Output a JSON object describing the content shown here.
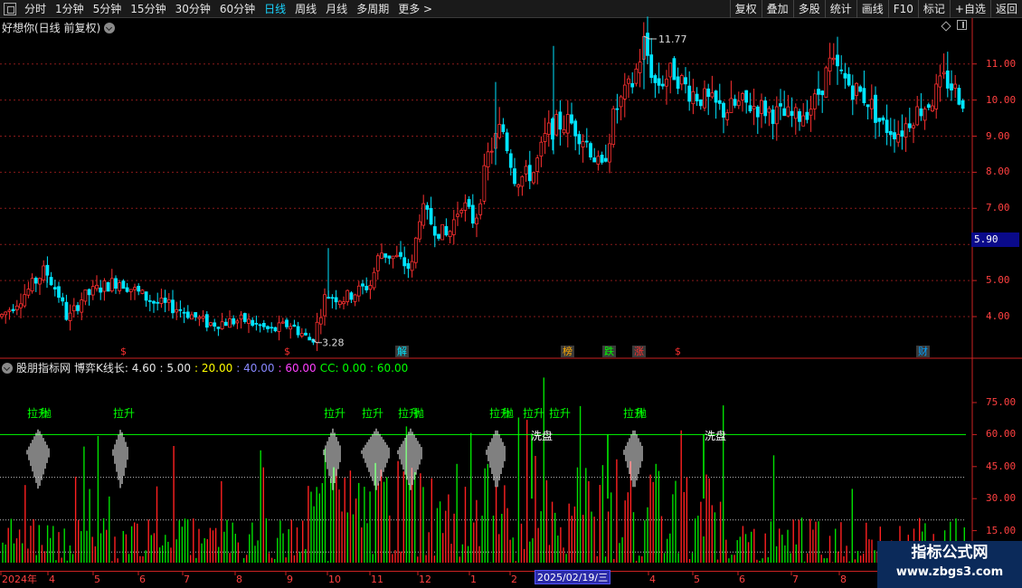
{
  "toolbar": {
    "timeframes": [
      "分时",
      "1分钟",
      "5分钟",
      "15分钟",
      "30分钟",
      "60分钟",
      "日线",
      "周线",
      "月线",
      "多周期",
      "更多 >"
    ],
    "active": "日线",
    "right_buttons": [
      "复权",
      "叠加",
      "多股",
      "统计",
      "画线",
      "F10",
      "标记",
      "+自选",
      "返回"
    ]
  },
  "main_panel": {
    "title": "好想你(日线 前复权)",
    "current_price": "5.90",
    "high_label": "11.77",
    "low_label": "3.28",
    "y_axis": [
      "11.00",
      "10.00",
      "9.00",
      "8.00",
      "7.00",
      "5.00",
      "4.00"
    ],
    "markers": [
      {
        "text": "$",
        "color": "#ff3030",
        "box": false
      },
      {
        "text": "$",
        "color": "#ff3030",
        "box": false
      },
      {
        "text": "解",
        "color": "#00e5ff",
        "box": true
      },
      {
        "text": "榜",
        "color": "#ffaa00",
        "box": true
      },
      {
        "text": "跌",
        "color": "#00ff00",
        "box": true
      },
      {
        "text": "涨",
        "color": "#ff3030",
        "box": true
      },
      {
        "text": "$",
        "color": "#ff3030",
        "box": false
      },
      {
        "text": "财",
        "color": "#00a0ff",
        "box": true
      }
    ]
  },
  "indicator_panel": {
    "name": "股朋指标网",
    "formula": "博弈K线长: 4.60",
    "params": [
      {
        "text": ": 5.00",
        "color": "#e6e6e6"
      },
      {
        "text": ": 20.00",
        "color": "#ffff00"
      },
      {
        "text": ": 40.00",
        "color": "#8888ff"
      },
      {
        "text": ": 60.00",
        "color": "#ff40ff"
      },
      {
        "text": "CC: 0.00",
        "color": "#00ff00"
      },
      {
        "text": ": 60.00",
        "color": "#00ff00"
      }
    ],
    "y_axis": [
      "75.00",
      "60.00",
      "45.00",
      "30.00",
      "15.00"
    ],
    "annotations": [
      {
        "text": "拉升",
        "type": "green"
      },
      {
        "text": "拉升",
        "type": "green"
      },
      {
        "text": "拉升",
        "type": "green"
      },
      {
        "text": "拉升",
        "type": "green"
      },
      {
        "text": "拉升",
        "type": "green"
      },
      {
        "text": "拉升",
        "type": "green"
      },
      {
        "text": "拉升",
        "type": "green"
      },
      {
        "text": "拉升",
        "type": "green"
      },
      {
        "text": "拉升",
        "type": "green"
      },
      {
        "text": "抛",
        "type": "green"
      },
      {
        "text": "抛",
        "type": "green"
      },
      {
        "text": "抛",
        "type": "green"
      },
      {
        "text": "抛",
        "type": "green"
      },
      {
        "text": "洗盘",
        "type": "white"
      },
      {
        "text": "洗盘",
        "type": "white"
      }
    ]
  },
  "date_axis": {
    "labels": [
      "2024年",
      "4",
      "5",
      "6",
      "7",
      "8",
      "9",
      "10",
      "11",
      "12",
      "1",
      "2",
      "4",
      "5",
      "6",
      "7",
      "8",
      "9"
    ],
    "selected": "2025/02/19/三"
  },
  "watermark": {
    "title": "指标公式网",
    "url": "www.zbgs3.com"
  },
  "colors": {
    "up": "#ff3030",
    "down": "#00e5ff",
    "grid": "#8a1a1a",
    "volume_up": "#ff2020",
    "volume_down": "#00e000",
    "line60": "#00ff00"
  },
  "chart_data": {
    "type": "candlestick",
    "title": "好想你(日线 前复权)",
    "ylim": [
      3.0,
      12.2
    ],
    "price_path": [
      [
        0,
        4.0
      ],
      [
        10,
        4.2
      ],
      [
        30,
        4.7
      ],
      [
        50,
        5.3
      ],
      [
        65,
        4.6
      ],
      [
        75,
        3.9
      ],
      [
        90,
        4.5
      ],
      [
        110,
        4.8
      ],
      [
        132,
        5.0
      ],
      [
        150,
        4.7
      ],
      [
        170,
        4.4
      ],
      [
        200,
        4.2
      ],
      [
        230,
        3.8
      ],
      [
        270,
        3.9
      ],
      [
        300,
        3.6
      ],
      [
        320,
        3.8
      ],
      [
        345,
        3.3
      ],
      [
        360,
        4.6
      ],
      [
        380,
        4.5
      ],
      [
        410,
        4.9
      ],
      [
        420,
        5.8
      ],
      [
        440,
        5.6
      ],
      [
        455,
        5.3
      ],
      [
        465,
        7.0
      ],
      [
        480,
        6.5
      ],
      [
        495,
        6.2
      ],
      [
        510,
        7.2
      ],
      [
        525,
        6.6
      ],
      [
        540,
        8.5
      ],
      [
        555,
        9.3
      ],
      [
        570,
        7.8
      ],
      [
        590,
        8.0
      ],
      [
        605,
        9.1
      ],
      [
        615,
        9.3
      ],
      [
        630,
        9.4
      ],
      [
        650,
        8.8
      ],
      [
        665,
        8.0
      ],
      [
        680,
        9.7
      ],
      [
        700,
        10.5
      ],
      [
        712,
        11.6
      ],
      [
        725,
        10.4
      ],
      [
        745,
        10.8
      ],
      [
        760,
        10.3
      ],
      [
        780,
        10.0
      ],
      [
        800,
        9.7
      ],
      [
        820,
        9.9
      ],
      [
        840,
        9.8
      ],
      [
        860,
        9.6
      ],
      [
        880,
        9.5
      ],
      [
        900,
        9.9
      ],
      [
        918,
        11.0
      ],
      [
        940,
        10.4
      ],
      [
        960,
        10.0
      ],
      [
        975,
        9.3
      ],
      [
        995,
        9.1
      ],
      [
        1010,
        9.6
      ],
      [
        1030,
        10.0
      ],
      [
        1045,
        10.6
      ],
      [
        1065,
        10.0
      ]
    ],
    "high": 11.77,
    "low": 3.28,
    "indicator": {
      "ylim": [
        0,
        95
      ],
      "line60": 60,
      "dotted": [
        40,
        20,
        5
      ]
    }
  }
}
